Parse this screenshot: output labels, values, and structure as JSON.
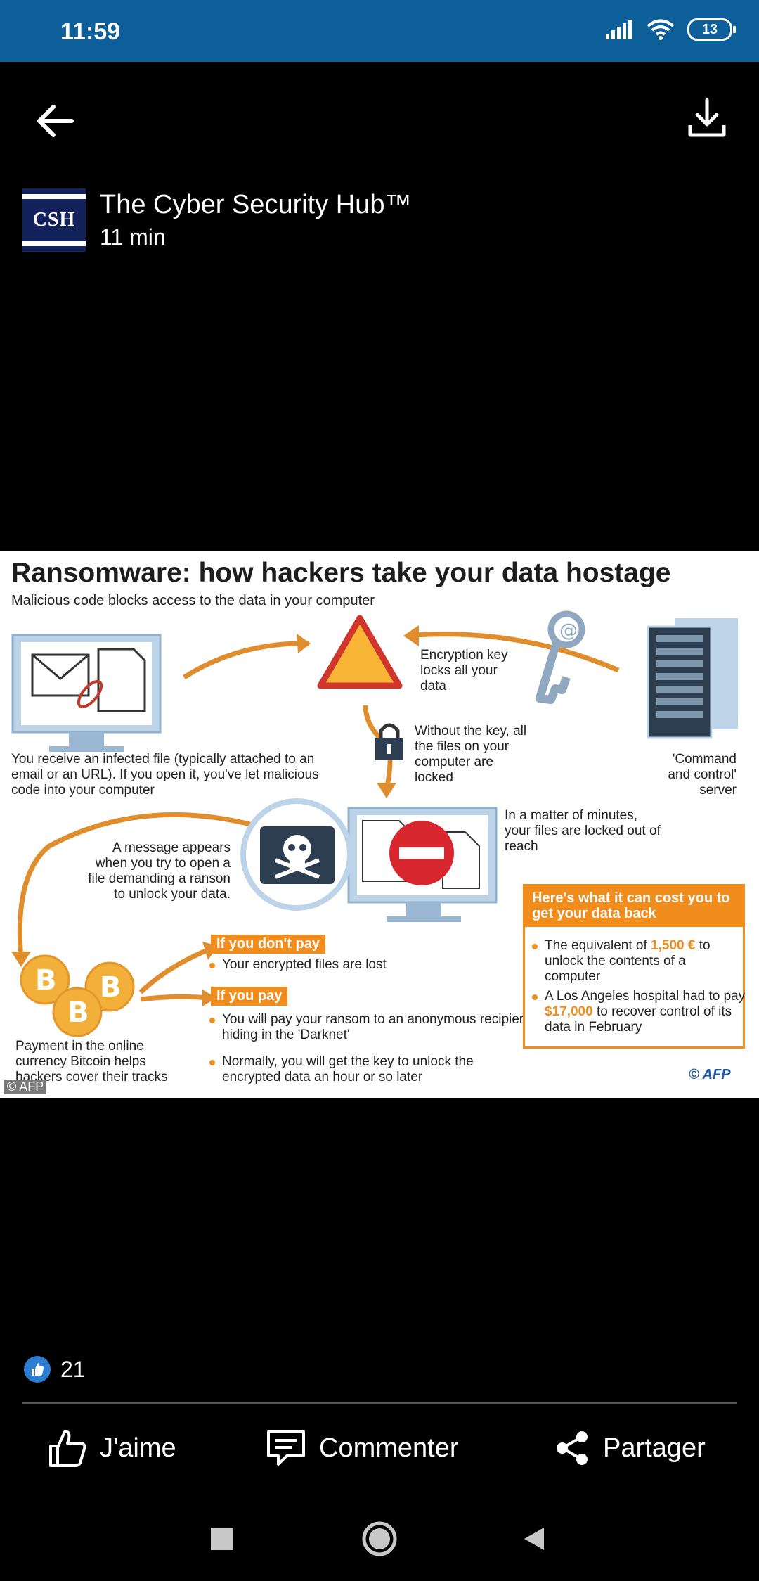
{
  "status_bar": {
    "time": "11:59",
    "battery": "13"
  },
  "post": {
    "author": "The Cyber Security Hub™",
    "avatar_text": "CSH",
    "time_ago": "11 min",
    "likes": "21"
  },
  "infographic": {
    "title": "Ransomware: how hackers take your data hostage",
    "subtitle": "Malicious code blocks access to the data in your computer",
    "infected_file_text": "You receive an infected file (typically attached to an email or an URL). If you open it, you've let malicious code into your computer",
    "encryption_key_text": "Encryption key locks all your data",
    "without_key_text": "Without the key, all the files on your computer are locked",
    "server_text": "'Command and control' server",
    "minutes_text": "In a matter of minutes, your files are locked out of reach",
    "message_text": "A message appears when you try to open a file demanding a ranson to unlock your data.",
    "if_dont_pay": "If you don't pay",
    "dont_pay_bullet": "Your encrypted files are lost",
    "if_pay": "If you pay",
    "pay_bullet_1": "You will pay your ransom to an anonymous recipient hiding in the 'Darknet'",
    "pay_bullet_2": "Normally, you will get the key to unlock the encrypted data an hour or so later",
    "bitcoin_text": "Payment in the online currency Bitcoin helps hackers cover their tracks",
    "cost_title": "Here's what it can cost you to get your data back",
    "cost_1_pre": "The equivalent of ",
    "cost_1_amount": "1,500 €",
    "cost_1_post": " to unlock the contents of a computer",
    "cost_2_pre": "A Los Angeles hospital had to pay ",
    "cost_2_amount": "$17,000",
    "cost_2_post": " to recover control of its data in February",
    "afp_logo": "© AFP",
    "credit": "© AFP"
  },
  "actions": {
    "like": "J'aime",
    "comment": "Commenter",
    "share": "Partager"
  },
  "colors": {
    "status_bar": "#0d5f9a",
    "accent_orange": "#f08d1c",
    "like_blue": "#2d7ed2"
  }
}
